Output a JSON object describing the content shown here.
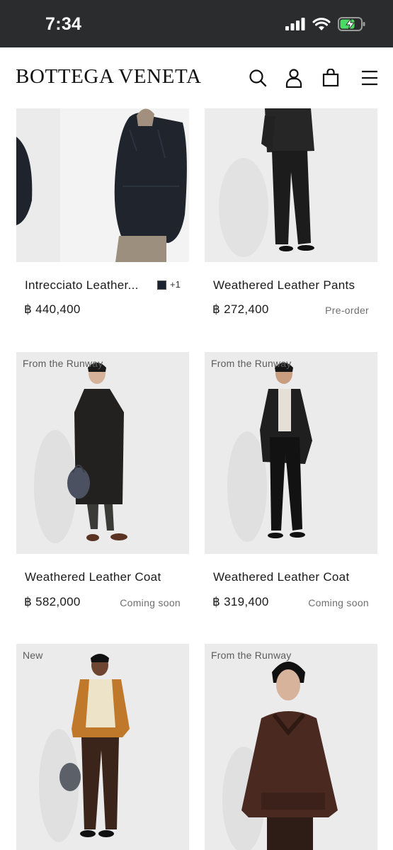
{
  "status_bar": {
    "time": "7:34",
    "icons": [
      "signal-icon",
      "wifi-icon",
      "battery-charging-icon"
    ]
  },
  "header": {
    "brand": "BOTTEGA VENETA",
    "icons": [
      "search-icon",
      "account-icon",
      "shopping-bag-icon",
      "menu-icon"
    ]
  },
  "products": [
    {
      "badge": "",
      "name": "Intrecciato Leather...",
      "price": "฿ 440,400",
      "status": "",
      "swatch_more": "+1"
    },
    {
      "badge": "",
      "name": "Weathered Leather Pants",
      "price": "฿ 272,400",
      "status": "Pre-order"
    },
    {
      "badge": "From the Runway",
      "name": "Weathered Leather Coat",
      "price": "฿ 582,000",
      "status": "Coming soon"
    },
    {
      "badge": "From the Runway",
      "name": "Weathered Leather Coat",
      "price": "฿ 319,400",
      "status": "Coming soon"
    },
    {
      "badge": "New",
      "name": "",
      "price": "",
      "status": ""
    },
    {
      "badge": "From the Runway",
      "name": "",
      "price": "",
      "status": ""
    }
  ],
  "colors": {
    "status_bar_bg": "#2b2c2e",
    "image_bg": "#eceded",
    "battery_charge": "#4cd964"
  }
}
